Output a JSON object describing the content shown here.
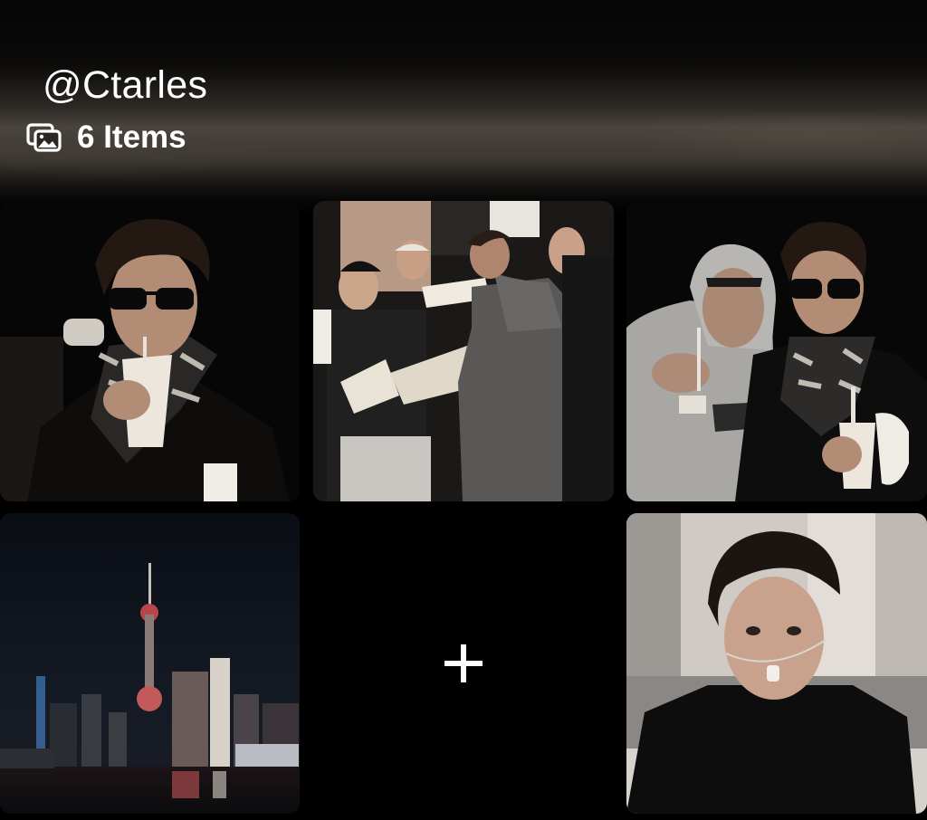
{
  "header": {
    "handle": "@Ctarles",
    "items_icon": "gallery-stack-icon",
    "items_count_label": "6 Items"
  },
  "grid": {
    "tiles": [
      {
        "name": "photo-man-sunglasses-drink",
        "kind": "photo"
      },
      {
        "name": "photo-signing-autographs-crowd",
        "kind": "photo"
      },
      {
        "name": "photo-two-men-hoodie-sunglasses",
        "kind": "photo"
      },
      {
        "name": "photo-city-skyline-night",
        "kind": "photo"
      },
      {
        "name": "add-item-tile",
        "kind": "add",
        "icon": "plus-icon"
      },
      {
        "name": "photo-man-portrait-chain",
        "kind": "photo"
      }
    ]
  },
  "colors": {
    "background": "#000000",
    "text": "#ffffff"
  }
}
